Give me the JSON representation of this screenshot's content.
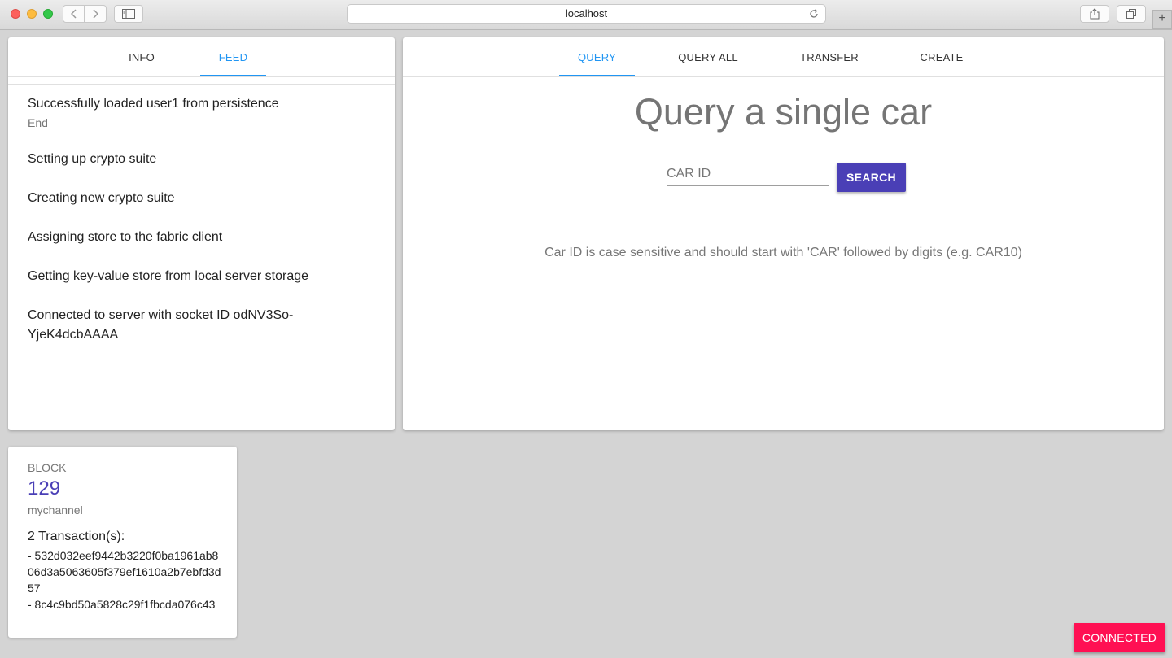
{
  "browser": {
    "url": "localhost",
    "back_icon": "chevron-left-icon",
    "forward_icon": "chevron-right-icon",
    "sidebar_icon": "sidebar-icon",
    "reload_icon": "reload-icon",
    "share_icon": "share-icon",
    "tabs_icon": "tabs-icon",
    "new_tab_label": "+"
  },
  "left_panel": {
    "tabs": [
      {
        "label": "INFO"
      },
      {
        "label": "FEED"
      }
    ],
    "active_tab": "FEED",
    "feed": [
      {
        "text": "Successfully loaded user1 from persistence",
        "sub": "End"
      },
      {
        "text": "Setting up crypto suite"
      },
      {
        "text": "Creating new crypto suite"
      },
      {
        "text": "Assigning store to the fabric client"
      },
      {
        "text": "Getting key-value store from local server storage"
      },
      {
        "text": "Connected to server with socket ID odNV3So-YjeK4dcbAAAA"
      }
    ]
  },
  "right_panel": {
    "tabs": [
      {
        "label": "QUERY"
      },
      {
        "label": "QUERY ALL"
      },
      {
        "label": "TRANSFER"
      },
      {
        "label": "CREATE"
      }
    ],
    "active_tab": "QUERY",
    "title": "Query a single car",
    "input_placeholder": "CAR ID",
    "input_value": "",
    "search_label": "SEARCH",
    "hint": "Car ID is case sensitive and should start with 'CAR' followed by digits (e.g. CAR10)"
  },
  "block": {
    "label": "BLOCK",
    "number": "129",
    "channel": "mychannel",
    "tx_count_label": "2 Transaction(s):",
    "transactions": [
      "- 532d032eef9442b3220f0ba1961ab806d3a5063605f379ef1610a2b7ebfd3d57",
      "- 8c4c9bd50a5828c29f1fbcda076c43"
    ]
  },
  "status": {
    "label": "CONNECTED"
  },
  "colors": {
    "accent_blue": "#2196f3",
    "primary": "#4a3fb6",
    "connected": "#ff1053"
  }
}
